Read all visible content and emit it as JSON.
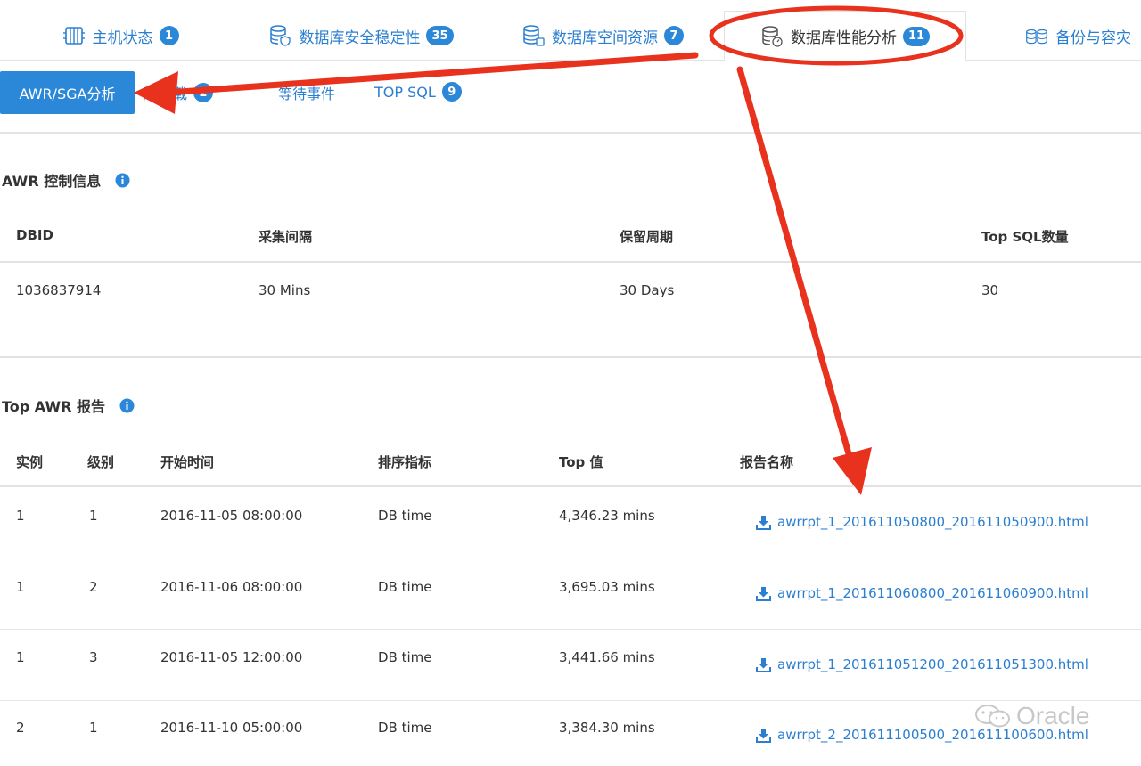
{
  "top_tabs": [
    {
      "label": "主机状态",
      "badge": "1",
      "icon": "server-icon"
    },
    {
      "label": "数据库安全稳定性",
      "badge": "35",
      "icon": "database-shield-icon"
    },
    {
      "label": "数据库空间资源",
      "badge": "7",
      "icon": "database-storage-icon"
    },
    {
      "label": "数据库性能分析",
      "badge": "11",
      "icon": "database-performance-icon",
      "active": true
    },
    {
      "label": "备份与容灾",
      "icon": "database-backup-icon"
    }
  ],
  "sub_tabs": {
    "active_label": "AWR/SGA分析",
    "items": [
      {
        "label": "负载",
        "partial_prefix": "阳",
        "badge": "2"
      },
      {
        "label": "等待事件"
      },
      {
        "label": "TOP SQL",
        "badge": "9"
      }
    ]
  },
  "awr_control": {
    "title": "AWR 控制信息",
    "headers": [
      "DBID",
      "采集间隔",
      "保留周期",
      "Top SQL数量"
    ],
    "row": [
      "1036837914",
      "30 Mins",
      "30 Days",
      "30"
    ]
  },
  "top_awr": {
    "title": "Top AWR 报告",
    "headers": [
      "实例",
      "级别",
      "开始时间",
      "排序指标",
      "Top 值",
      "报告名称"
    ],
    "rows": [
      [
        "1",
        "1",
        "2016-11-05 08:00:00",
        "DB time",
        "4,346.23 mins",
        "awrrpt_1_201611050800_201611050900.html"
      ],
      [
        "1",
        "2",
        "2016-11-06 08:00:00",
        "DB time",
        "3,695.03 mins",
        "awrrpt_1_201611060800_201611060900.html"
      ],
      [
        "1",
        "3",
        "2016-11-05 12:00:00",
        "DB time",
        "3,441.66 mins",
        "awrrpt_1_201611051200_201611051300.html"
      ],
      [
        "2",
        "1",
        "2016-11-10 05:00:00",
        "DB time",
        "3,384.30 mins",
        "awrrpt_2_201611100500_201611100600.html"
      ]
    ]
  },
  "watermark": "Oracle",
  "colors": {
    "accent": "#2b87d8",
    "link": "#2b7fd0",
    "annotation": "#e8321e"
  }
}
